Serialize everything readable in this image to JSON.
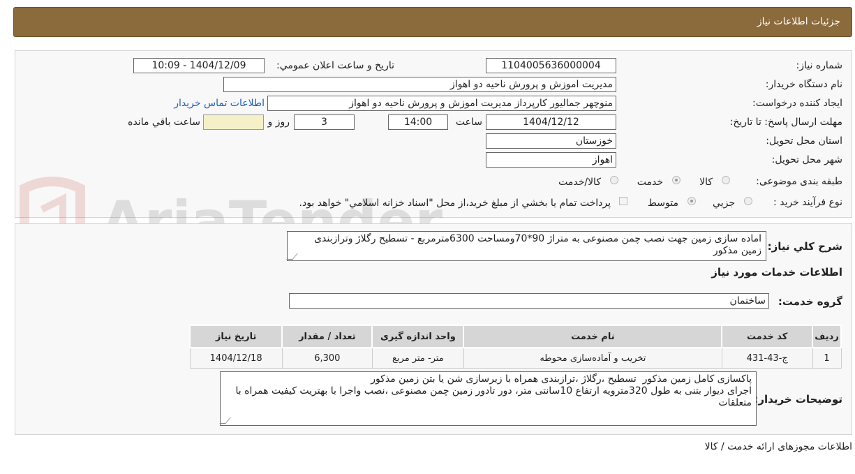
{
  "header": {
    "title": "جزئیات اطلاعات نیاز"
  },
  "form": {
    "need_number_label": "شماره نیاز:",
    "need_number": "1104005636000004",
    "announce_label": "تاریخ و ساعت اعلان عمومي:",
    "announce_value": "1404/12/09 - 10:09",
    "buyer_org_label": "نام دستگاه خريدار:",
    "buyer_org": "مديريت اموزش و پرورش ناحيه دو اهواز",
    "creator_label": "ايجاد کننده درخواست:",
    "creator": "منوچهر  جماليور کارپرداز مديريت اموزش و پرورش ناحيه دو اهواز",
    "contact_link": "اطلاعات تماس خريدار",
    "deadline_label": "مهلت ارسال پاسخ: تا تاريخ:",
    "deadline_date": "1404/12/12",
    "time_label": "ساعت",
    "deadline_time": "14:00",
    "days_value": "3",
    "days_label": "روز و",
    "remaining_value": "",
    "remaining_label": "ساعت باقي مانده",
    "province_label": "استان محل تحويل:",
    "province": "خوزستان",
    "city_label": "شهر محل تحويل:",
    "city": "اهواز",
    "category_label": "طبقه بندی موضوعی:",
    "category_options": [
      "کالا",
      "خدمت",
      "کالا/خدمت"
    ],
    "category_selected": "خدمت",
    "process_label": "نوع فرآيند خريد :",
    "process_options": [
      "جزيي",
      "متوسط"
    ],
    "process_selected": "متوسط",
    "payment_note": "پرداخت تمام يا بخشي از مبلغ خريد،از محل \"اسناد خزانه اسلامي\" خواهد بود."
  },
  "details": {
    "summary_label": "شرح کلي نياز:",
    "summary_text": "اماده سازی زمین جهت نصب چمن مصنوعی به متراژ 90*70ومساحت 6300مترمربع - تسطیح رگلاژ وترازبندی زمین مذکور",
    "services_heading": "اطلاعات خدمات مورد نياز",
    "service_group_label": "گروه خدمت:",
    "service_group": "ساختمان",
    "table": {
      "headers": [
        "رديف",
        "کد خدمت",
        "نام خدمت",
        "واحد اندازه گيری",
        "تعداد / مقدار",
        "تاريخ نياز"
      ],
      "rows": [
        [
          "1",
          "ج-43-431",
          "تخريب و آماده‌سازی محوطه",
          "متر- متر مربع",
          "6,300",
          "1404/12/18"
        ]
      ]
    },
    "buyer_notes_label": "توضيحات خريدار:",
    "buyer_notes": "پاکسازی کامل زمین مذکور  تسطیح ،رگلاژ ،ترازبندی همراه با زیرسازی شن یا بتن زمین مذکور\nاجرای دیوار بتنی به طول 320مترویه ارتفاع 10سانتی متر، دور تادور زمین چمن مصنوعی ،نصب واجرا با بهتریت کیفیت همراه با متعلقات"
  },
  "footer": {
    "permits_text": "اطلاعات مجوزهای ارائه خدمت / کالا"
  },
  "watermark": {
    "text": "AriaTender.neT"
  },
  "colors": {
    "header_bg": "#8b6a3b",
    "link": "#1a5fb4",
    "table_header_bg": "#d6d6d6"
  }
}
